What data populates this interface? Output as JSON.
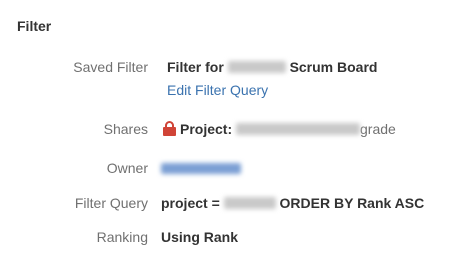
{
  "section": {
    "title": "Filter"
  },
  "fields": {
    "saved_filter": {
      "label": "Saved Filter",
      "value_prefix": "Filter for",
      "value_suffix": "Scrum Board",
      "edit_link": "Edit Filter Query"
    },
    "shares": {
      "label": "Shares",
      "value_prefix": "Project:",
      "value_suffix": "grade",
      "icon": "lock-icon"
    },
    "owner": {
      "label": "Owner"
    },
    "filter_query": {
      "label": "Filter Query",
      "value_prefix": "project =",
      "value_suffix": "ORDER BY Rank ASC"
    },
    "ranking": {
      "label": "Ranking",
      "value": "Using Rank"
    }
  },
  "colors": {
    "link": "#3b73af",
    "lock": "#d04437",
    "label": "#707070",
    "text": "#333333"
  }
}
